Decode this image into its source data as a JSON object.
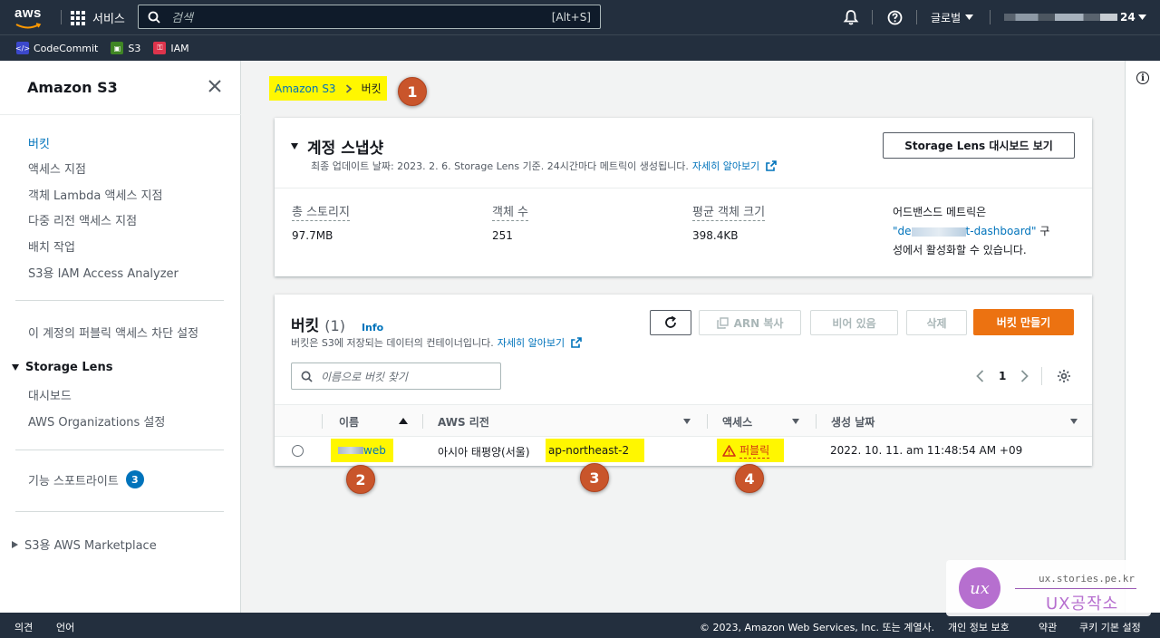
{
  "topnav": {
    "logo_text": "aws",
    "services_label": "서비스",
    "search_placeholder": "검색",
    "search_shortcut": "[Alt+S]",
    "region_label": "글로벌",
    "account_suffix": "24"
  },
  "favorites": [
    {
      "label": "CodeCommit",
      "icon": "codecommit-icon",
      "color": "#3b48cc"
    },
    {
      "label": "S3",
      "icon": "s3-icon",
      "color": "#3f8624"
    },
    {
      "label": "IAM",
      "icon": "iam-icon",
      "color": "#dd344c"
    }
  ],
  "sidebar": {
    "title": "Amazon S3",
    "items": [
      {
        "label": "버킷"
      },
      {
        "label": "액세스 지점"
      },
      {
        "label": "객체 Lambda 액세스 지점"
      },
      {
        "label": "다중 리전 액세스 지점"
      },
      {
        "label": "배치 작업"
      },
      {
        "label": "S3용 IAM Access Analyzer"
      }
    ],
    "block_public": "이 계정의 퍼블릭 액세스 차단 설정",
    "storage_lens": {
      "label": "Storage Lens",
      "items": [
        {
          "label": "대시보드"
        },
        {
          "label": "AWS Organizations 설정"
        }
      ]
    },
    "spotlight": {
      "label": "기능 스포트라이트",
      "badge": "3"
    },
    "marketplace": "S3용 AWS Marketplace"
  },
  "breadcrumb": {
    "root": "Amazon S3",
    "current": "버킷"
  },
  "markers": [
    "1",
    "2",
    "3",
    "4"
  ],
  "snapshot": {
    "title": "계정 스냅샷",
    "subtitle": "최종 업데이트 날짜: 2023. 2. 6. Storage Lens 기준. 24시간마다 메트릭이 생성됩니다.",
    "learn_more": "자세히 알아보기",
    "dashboard_button": "Storage Lens 대시보드 보기",
    "metrics": [
      {
        "label": "총 스토리지",
        "value": "97.7MB"
      },
      {
        "label": "객체 수",
        "value": "251"
      },
      {
        "label": "평균 객체 크기",
        "value": "398.4KB"
      }
    ],
    "advanced": {
      "line1": "어드밴스드 메트릭은",
      "link_start": "\"de",
      "link_end": "t-dashboard\"",
      "line2_after": " 구",
      "line3": "성에서 활성화할 수 있습니다."
    }
  },
  "buckets": {
    "title": "버킷",
    "count": "(1)",
    "info": "Info",
    "subtitle": "버킷은 S3에 저장되는 데이터의 컨테이너입니다.",
    "learn_more": "자세히 알아보기",
    "buttons": {
      "arn_copy": "ARN 복사",
      "empty": "비어 있음",
      "delete": "삭제",
      "create": "버킷 만들기"
    },
    "search_placeholder": "이름으로 버킷 찾기",
    "page": "1",
    "columns": [
      "이름",
      "AWS 리전",
      "액세스",
      "생성 날짜"
    ],
    "rows": [
      {
        "name_suffix": "web",
        "region_name": "아시아 태평양(서울)",
        "region_code": "ap-northeast-2",
        "access": "퍼블릭",
        "created": "2022. 10. 11. am 11:48:54 AM +09"
      }
    ]
  },
  "footer": {
    "feedback": "의견",
    "language": "언어",
    "copyright": "© 2023, Amazon Web Services, Inc. 또는 계열사.",
    "privacy": "개인 정보 보호",
    "terms": "약관",
    "cookies": "쿠키 기본 설정"
  },
  "watermark": {
    "url": "ux.stories.pe.kr",
    "name": "UX공작소"
  },
  "colors": {
    "nav_bg": "#232f3e",
    "link": "#0073bb",
    "primary": "#ec7211",
    "highlight": "#fff700",
    "marker": "#c9552b",
    "danger": "#d13212"
  }
}
